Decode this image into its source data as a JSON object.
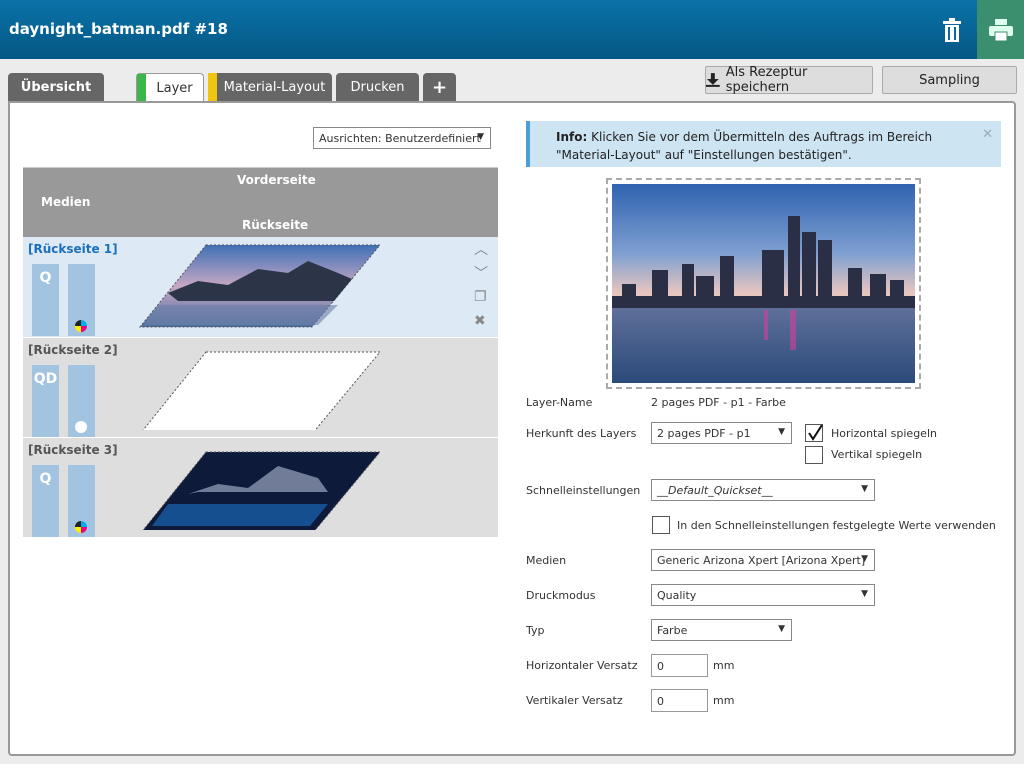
{
  "header": {
    "title": "daynight_batman.pdf #18",
    "trash_icon": "trash-icon",
    "print_icon": "printer-icon"
  },
  "tabs": [
    {
      "label": "Übersicht"
    },
    {
      "label": "Layer",
      "mark_color": "#3cb54a"
    },
    {
      "label": "Material-Layout",
      "mark_color": "#f1c40f"
    },
    {
      "label": "Drucken"
    },
    {
      "label": "+"
    }
  ],
  "actions": {
    "save_recipe": "Als Rezeptur speichern",
    "sampling": "Sampling"
  },
  "left": {
    "align_select": "Ausrichten: Benutzerdefiniert",
    "grid_header": {
      "front": "Vorderseite",
      "media": "Medien",
      "back": "Rückseite"
    },
    "rows": [
      {
        "title": "[Rückseite 1]",
        "mode": "Q"
      },
      {
        "title": "[Rückseite 2]",
        "mode": "QD"
      },
      {
        "title": "[Rückseite 3]",
        "mode": "Q"
      }
    ]
  },
  "info": {
    "label": "Info:",
    "text": "Klicken Sie vor dem Übermitteln des Auftrags im Bereich \"Material-Layout\" auf \"Einstellungen bestätigen\"."
  },
  "form": {
    "layer_name": {
      "label": "Layer-Name",
      "value": "2 pages PDF - p1 - Farbe"
    },
    "origin": {
      "label": "Herkunft des Layers",
      "value": "2 pages PDF - p1"
    },
    "mirror_h": {
      "label": "Horizontal spiegeln",
      "checked": true
    },
    "mirror_v": {
      "label": "Vertikal spiegeln",
      "checked": false
    },
    "quickset": {
      "label": "Schnelleinstellungen",
      "value": "__Default_Quickset__"
    },
    "use_quickset": {
      "label": "In den Schnelleinstellungen festgelegte Werte verwenden"
    },
    "media": {
      "label": "Medien",
      "value": "Generic Arizona Xpert [Arizona Xpert]"
    },
    "print_mode": {
      "label": "Druckmodus",
      "value": "Quality"
    },
    "type": {
      "label": "Typ",
      "value": "Farbe"
    },
    "h_offset": {
      "label": "Horizontaler Versatz",
      "value": "0",
      "unit": "mm"
    },
    "v_offset": {
      "label": "Vertikaler Versatz",
      "value": "0",
      "unit": "mm"
    }
  }
}
